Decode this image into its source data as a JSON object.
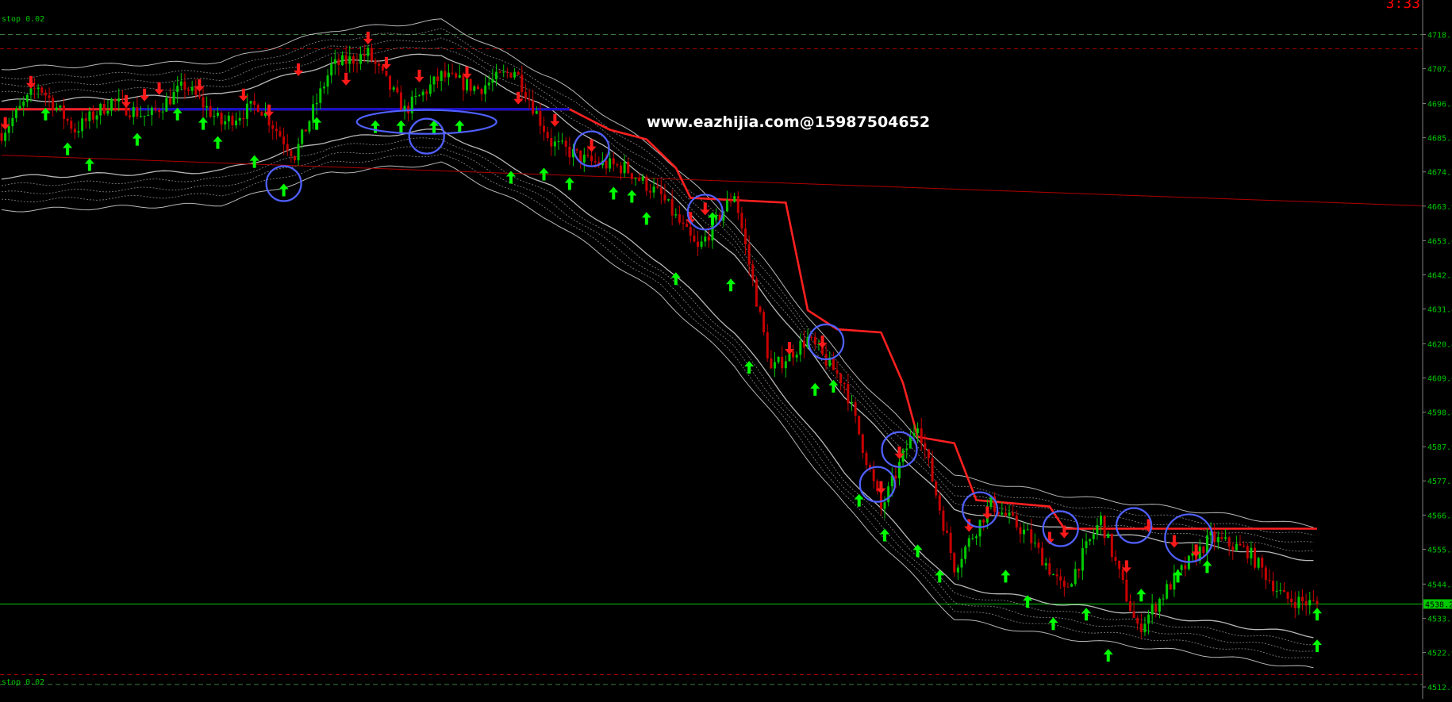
{
  "header": {
    "timer_text": "3:33"
  },
  "labels": {
    "stop_top": "stop 0.02",
    "stop_bottom": "stop 0.02"
  },
  "watermark": {
    "text": "www.eazhijia.com@15987504652"
  },
  "colors": {
    "background": "#000000",
    "bull_candle": "#00c800",
    "bear_candle": "#c80000",
    "up_arrow": "#00ff00",
    "down_arrow": "#ff1a1a",
    "stop_line": "#ff2020",
    "level_line": "#1010d0",
    "band_main": "#d8d8d8",
    "band_dotted": "#a0a0a0",
    "trend_line": "#b00000",
    "current_price_line": "#00c800",
    "circle": "#5060ff",
    "axis_text": "#00c800",
    "timer": "#ff0000"
  },
  "chart_data": {
    "type": "candlestick",
    "title": "",
    "ylim": [
      4509.5,
      4724.5
    ],
    "y_ticks": [
      "4718.1",
      "4707.3",
      "4696.3",
      "4685.5",
      "4674.7",
      "4663.9",
      "4653.0",
      "4642.2",
      "4631.4",
      "4620.4",
      "4609.6",
      "4598.8",
      "4587.9",
      "4577.1",
      "4566.3",
      "4555.5",
      "4544.5",
      "4533.7",
      "4522.9",
      "4512.0"
    ],
    "current_price_label": "4538.2",
    "current_price": 4538.2,
    "stop_levels": [
      4718.1,
      4512.8
    ],
    "red_dashed_levels": [
      4713.6,
      4515.9
    ],
    "bar_count": 360,
    "price_path": [
      [
        0,
        4687
      ],
      [
        10,
        4702
      ],
      [
        20,
        4688
      ],
      [
        30,
        4697
      ],
      [
        40,
        4692
      ],
      [
        50,
        4702
      ],
      [
        60,
        4690
      ],
      [
        70,
        4696
      ],
      [
        80,
        4680
      ],
      [
        90,
        4708
      ],
      [
        100,
        4712
      ],
      [
        110,
        4694
      ],
      [
        120,
        4705
      ],
      [
        130,
        4701
      ],
      [
        140,
        4707
      ],
      [
        150,
        4684
      ],
      [
        160,
        4678
      ],
      [
        170,
        4676
      ],
      [
        180,
        4667
      ],
      [
        190,
        4650
      ],
      [
        200,
        4668
      ],
      [
        210,
        4612
      ],
      [
        220,
        4622
      ],
      [
        230,
        4608
      ],
      [
        240,
        4568
      ],
      [
        250,
        4596
      ],
      [
        260,
        4550
      ],
      [
        270,
        4570
      ],
      [
        280,
        4560
      ],
      [
        290,
        4542
      ],
      [
        300,
        4565
      ],
      [
        310,
        4530
      ],
      [
        320,
        4546
      ],
      [
        330,
        4559
      ],
      [
        340,
        4555
      ],
      [
        350,
        4540
      ],
      [
        359,
        4538
      ]
    ],
    "band_center_path": [
      [
        0,
        4685
      ],
      [
        60,
        4687
      ],
      [
        90,
        4697
      ],
      [
        120,
        4700
      ],
      [
        150,
        4682
      ],
      [
        180,
        4658
      ],
      [
        200,
        4636
      ],
      [
        230,
        4592
      ],
      [
        260,
        4556
      ],
      [
        290,
        4550
      ],
      [
        320,
        4546
      ],
      [
        359,
        4540
      ]
    ],
    "stop_line_steps": [
      [
        155,
        4694.5
      ],
      [
        166,
        4688
      ],
      [
        176,
        4685
      ],
      [
        184,
        4676
      ],
      [
        188,
        4666.5
      ],
      [
        214,
        4665
      ],
      [
        220,
        4631
      ],
      [
        228,
        4625
      ],
      [
        240,
        4624
      ],
      [
        246,
        4608
      ],
      [
        250,
        4591
      ],
      [
        260,
        4589
      ],
      [
        266,
        4571
      ],
      [
        286,
        4569
      ],
      [
        290,
        4562
      ],
      [
        359,
        4562
      ]
    ],
    "level_line": {
      "value": 4694.5,
      "from": 0,
      "to": 155
    },
    "trend_line": {
      "from": [
        0,
        4680
      ],
      "to": [
        359,
        4664
      ]
    },
    "up_arrows": [
      [
        12,
        4693
      ],
      [
        18,
        4682
      ],
      [
        24,
        4677
      ],
      [
        37,
        4685
      ],
      [
        48,
        4693
      ],
      [
        55,
        4690
      ],
      [
        59,
        4684
      ],
      [
        69,
        4678
      ],
      [
        77,
        4669
      ],
      [
        86,
        4690
      ],
      [
        102,
        4689
      ],
      [
        109,
        4689
      ],
      [
        118,
        4689
      ],
      [
        125,
        4689
      ],
      [
        139,
        4673
      ],
      [
        148,
        4674
      ],
      [
        155,
        4671
      ],
      [
        167,
        4668
      ],
      [
        172,
        4667
      ],
      [
        176,
        4660
      ],
      [
        184,
        4641
      ],
      [
        194,
        4660
      ],
      [
        199,
        4639
      ],
      [
        204,
        4613
      ],
      [
        222,
        4606
      ],
      [
        227,
        4607
      ],
      [
        234,
        4571
      ],
      [
        241,
        4560
      ],
      [
        250,
        4555
      ],
      [
        256,
        4547
      ],
      [
        274,
        4547
      ],
      [
        280,
        4539
      ],
      [
        287,
        4532
      ],
      [
        296,
        4535
      ],
      [
        302,
        4522
      ],
      [
        311,
        4541
      ],
      [
        321,
        4547
      ],
      [
        329,
        4550
      ],
      [
        359,
        4525
      ],
      [
        363,
        4535
      ]
    ],
    "down_arrows": [
      [
        1,
        4690
      ],
      [
        8,
        4703
      ],
      [
        34,
        4697
      ],
      [
        39,
        4699
      ],
      [
        43,
        4701
      ],
      [
        54,
        4702
      ],
      [
        66,
        4699
      ],
      [
        73,
        4694
      ],
      [
        81,
        4707
      ],
      [
        94,
        4704
      ],
      [
        100,
        4717
      ],
      [
        105,
        4709
      ],
      [
        114,
        4705
      ],
      [
        127,
        4706
      ],
      [
        141,
        4698
      ],
      [
        151,
        4691
      ],
      [
        161,
        4683
      ],
      [
        188,
        4660
      ],
      [
        192,
        4663
      ],
      [
        215,
        4619
      ],
      [
        224,
        4621
      ],
      [
        240,
        4575
      ],
      [
        245,
        4586
      ],
      [
        264,
        4563
      ],
      [
        269,
        4567
      ],
      [
        286,
        4559
      ],
      [
        290,
        4561
      ],
      [
        307,
        4550
      ],
      [
        313,
        4563
      ],
      [
        320,
        4558
      ],
      [
        326,
        4555
      ]
    ],
    "circles": [
      [
        77,
        4671
      ],
      [
        116,
        4686
      ],
      [
        161,
        4682
      ],
      [
        192,
        4662
      ],
      [
        225,
        4621
      ],
      [
        239,
        4576
      ],
      [
        245,
        4587
      ],
      [
        267,
        4568
      ],
      [
        289,
        4562
      ],
      [
        309,
        4563
      ],
      [
        324,
        4559
      ]
    ]
  }
}
